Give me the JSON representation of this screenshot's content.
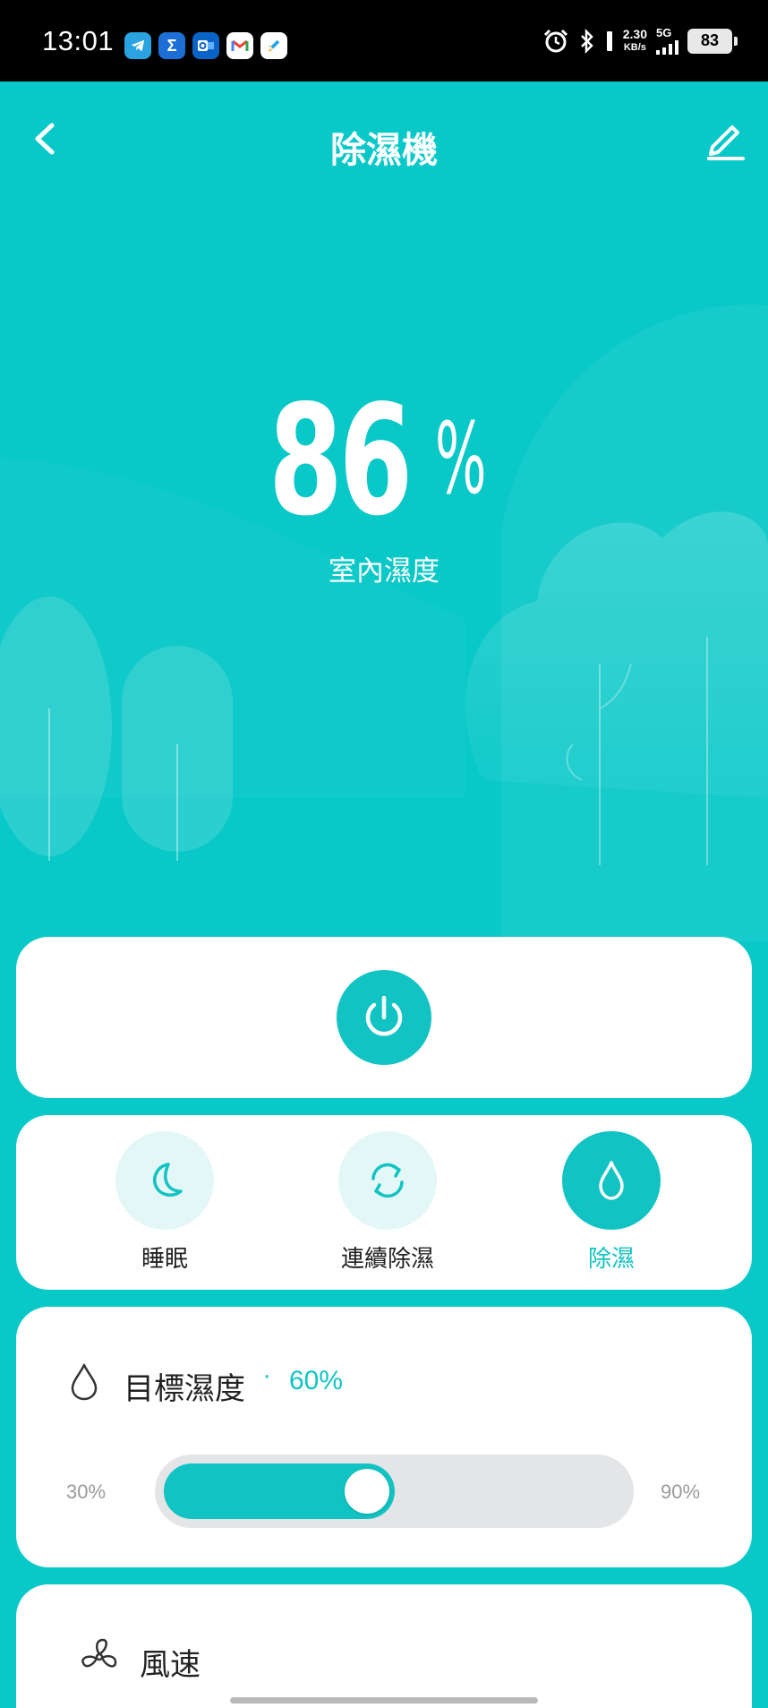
{
  "status_bar": {
    "time": "13:01",
    "apps": [
      {
        "name": "telegram-icon",
        "glyph": "✈",
        "color": "#2aa3e0"
      },
      {
        "name": "sigma-app-icon",
        "glyph": "Σ",
        "color": "#1d6fd6"
      },
      {
        "name": "outlook-icon",
        "glyph": "O",
        "color": "#0a64c8"
      },
      {
        "name": "gmail-icon",
        "glyph": "M",
        "color": "#ffffff"
      },
      {
        "name": "rocket-app-icon",
        "glyph": "🚀",
        "color": "#ffffff"
      }
    ],
    "net_speed": "2.30",
    "net_unit": "KB/s",
    "network": "5G",
    "battery": "83"
  },
  "header": {
    "title": "除濕機"
  },
  "humidity": {
    "value": "86",
    "unit": "%",
    "label": "室內濕度"
  },
  "modes": [
    {
      "label": "睡眠",
      "icon": "moon-icon",
      "active": false
    },
    {
      "label": "連續除濕",
      "icon": "cycle-icon",
      "active": false
    },
    {
      "label": "除濕",
      "icon": "water-drop-icon",
      "active": true
    }
  ],
  "target": {
    "title": "目標濕度",
    "separator": "·",
    "value": "60%",
    "min": "30%",
    "max": "90%",
    "slider_fraction": 0.5
  },
  "fan": {
    "title": "風速"
  },
  "colors": {
    "accent": "#12c3c3",
    "background": "#09c8c8",
    "mode_inactive_bg": "#e4f7f7",
    "slider_track": "#e3e5e7"
  }
}
